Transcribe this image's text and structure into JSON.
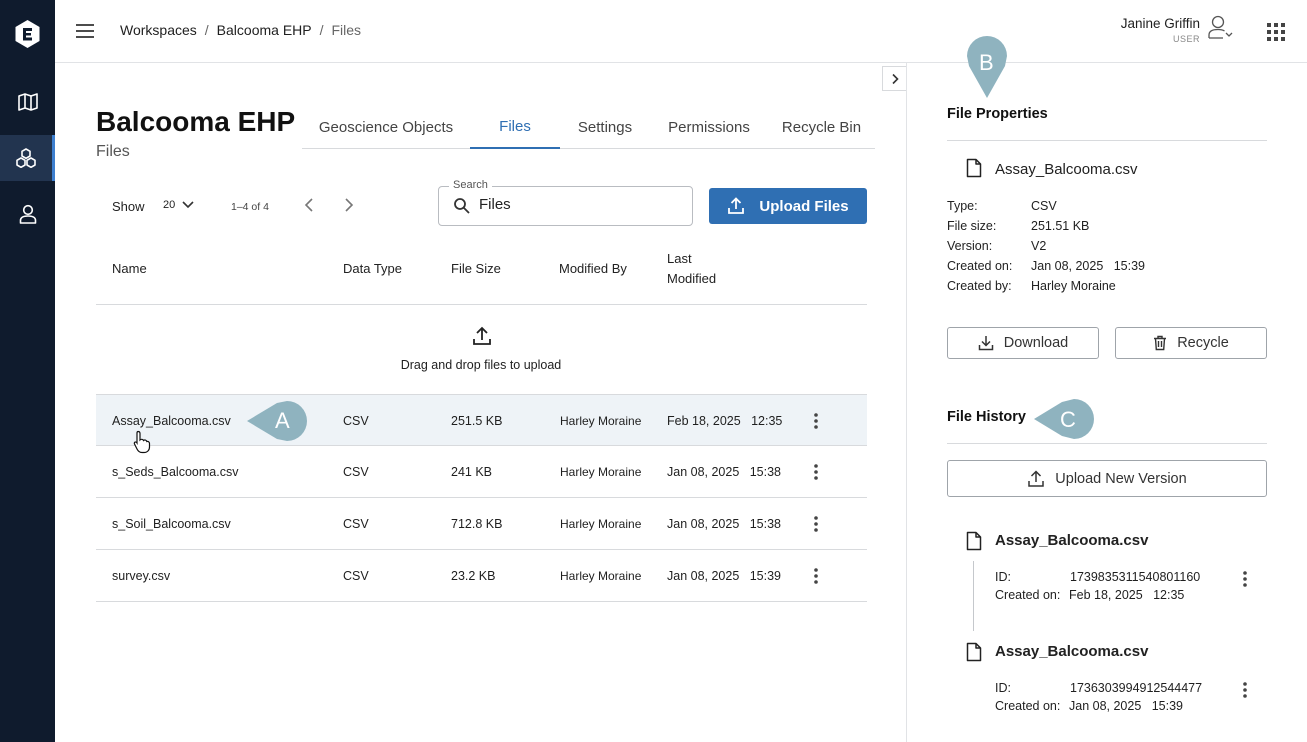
{
  "sidebar": {
    "logo": "evo-logo",
    "items": [
      {
        "name": "map-icon"
      },
      {
        "name": "workspaces-icon",
        "active": true
      },
      {
        "name": "user-icon"
      }
    ]
  },
  "header": {
    "breadcrumb": [
      "Workspaces",
      "Balcooma EHP",
      "Files"
    ],
    "breadcrumb_sep": "/",
    "user_name": "Janine Griffin",
    "user_role": "USER"
  },
  "page": {
    "title": "Balcooma EHP",
    "subtitle": "Files",
    "tabs": [
      {
        "label": "Geoscience Objects",
        "active": false
      },
      {
        "label": "Files",
        "active": true
      },
      {
        "label": "Settings",
        "active": false
      },
      {
        "label": "Permissions",
        "active": false
      },
      {
        "label": "Recycle Bin",
        "active": false
      }
    ]
  },
  "toolbar": {
    "show_label": "Show",
    "show_value": "20",
    "pager_text": "1–4 of 4",
    "search_label": "Search",
    "search_value": "Files",
    "upload_label": "Upload Files"
  },
  "table": {
    "columns": [
      "Name",
      "Data Type",
      "File Size",
      "Modified By",
      "Last",
      "Modified"
    ],
    "dropzone_text": "Drag and drop files to upload",
    "rows": [
      {
        "name": "Assay_Balcooma.csv",
        "type": "CSV",
        "size": "251.5 KB",
        "by": "Harley Moraine",
        "modified": "Feb 18, 2025   12:35",
        "selected": true
      },
      {
        "name": "s_Seds_Balcooma.csv",
        "type": "CSV",
        "size": "241 KB",
        "by": "Harley Moraine",
        "modified": "Jan 08, 2025   15:38"
      },
      {
        "name": "s_Soil_Balcooma.csv",
        "type": "CSV",
        "size": "712.8 KB",
        "by": "Harley Moraine",
        "modified": "Jan 08, 2025   15:38"
      },
      {
        "name": "survey.csv",
        "type": "CSV",
        "size": "23.2 KB",
        "by": "Harley Moraine",
        "modified": "Jan 08, 2025   15:39"
      }
    ]
  },
  "callouts": {
    "a": "A",
    "b": "B",
    "c": "C",
    "color": "#8fb3bf"
  },
  "properties": {
    "heading": "File Properties",
    "file_name": "Assay_Balcooma.csv",
    "labels": [
      "Type:",
      "File size:",
      "Version:",
      "Created on:",
      "Created by:"
    ],
    "values": [
      "CSV",
      "251.51 KB",
      "V2",
      "Jan 08, 2025   15:39",
      "Harley Moraine"
    ],
    "download_label": "Download",
    "recycle_label": "Recycle"
  },
  "history": {
    "heading": "File History",
    "upload_label": "Upload New Version",
    "id_label": "ID:",
    "created_label": "Created on:",
    "versions": [
      {
        "name": "Assay_Balcooma.csv",
        "id": "1739835311540801160",
        "created": "Feb 18, 2025   12:35"
      },
      {
        "name": "Assay_Balcooma.csv",
        "id": "1736303994912544477",
        "created": "Jan 08, 2025   15:39"
      }
    ]
  },
  "colors": {
    "sidebar": "#0f1b2d",
    "accent": "#2f6fb3",
    "selected_row": "#eef3f7"
  }
}
